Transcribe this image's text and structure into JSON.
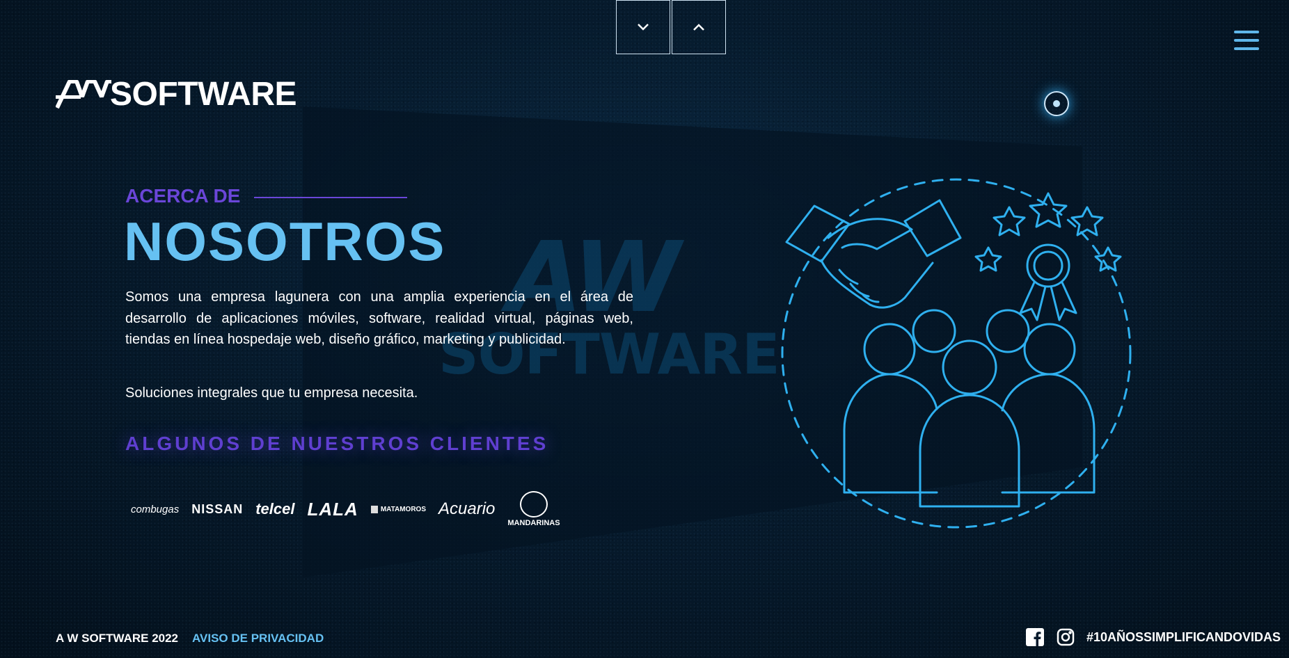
{
  "brand": {
    "logo_mark": "AW",
    "logo_text": "SOFTWARE"
  },
  "nav": {
    "down_icon": "chevron-down-icon",
    "up_icon": "chevron-up-icon",
    "menu_icon": "hamburger-menu-icon"
  },
  "watermark": {
    "mark": "AW",
    "text": "SOFTWARE"
  },
  "about": {
    "eyebrow": "ACERCA DE",
    "title": "NOSOTROS",
    "body": "Somos una empresa lagunera con una amplia experiencia en el área de desarrollo de aplicaciones móviles, software, realidad virtual, páginas web, tiendas en línea hospedaje web, diseño gráfico, marketing y publicidad.",
    "tagline": "Soluciones integrales que tu empresa necesita."
  },
  "clients": {
    "title": "ALGUNOS DE NUESTROS CLIENTES",
    "logos": [
      "combugas",
      "NISSAN",
      "telcel",
      "LALA",
      "MATAMOROS",
      "Acuario",
      "MANDARINAS"
    ]
  },
  "footer": {
    "copyright": "A W SOFTWARE 2022",
    "privacy": "AVISO DE PRIVACIDAD",
    "hashtag": "#10AÑOSSIMPLIFICANDOVIDAS",
    "social": [
      "facebook-icon",
      "instagram-icon"
    ]
  },
  "colors": {
    "accent_blue": "#66c1f2",
    "accent_purple": "#6a46d8",
    "neon": "#2fb0ef"
  }
}
